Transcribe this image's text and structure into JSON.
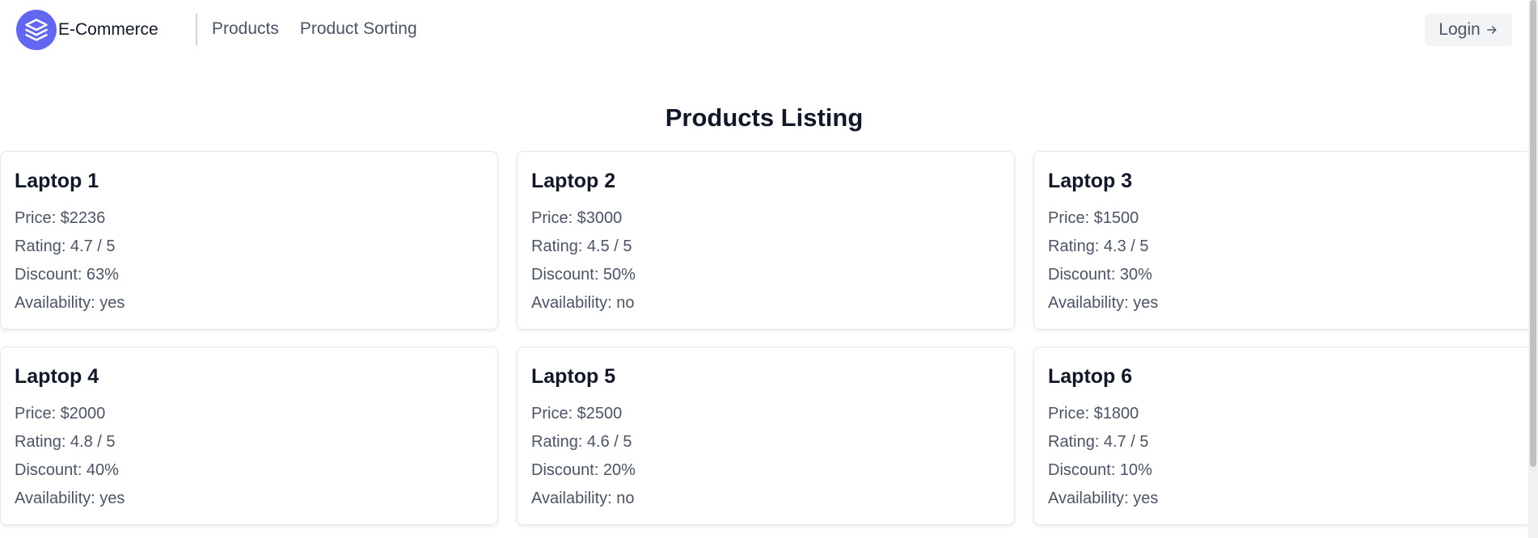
{
  "header": {
    "brand": "E-Commerce",
    "nav": [
      {
        "label": "Products"
      },
      {
        "label": "Product Sorting"
      }
    ],
    "login_label": "Login"
  },
  "main": {
    "title": "Products Listing",
    "products": [
      {
        "name": "Laptop 1",
        "price": "Price: $2236",
        "rating": "Rating: 4.7 / 5",
        "discount": "Discount: 63%",
        "availability": "Availability: yes"
      },
      {
        "name": "Laptop 2",
        "price": "Price: $3000",
        "rating": "Rating: 4.5 / 5",
        "discount": "Discount: 50%",
        "availability": "Availability: no"
      },
      {
        "name": "Laptop 3",
        "price": "Price: $1500",
        "rating": "Rating: 4.3 / 5",
        "discount": "Discount: 30%",
        "availability": "Availability: yes"
      },
      {
        "name": "Laptop 4",
        "price": "Price: $2000",
        "rating": "Rating: 4.8 / 5",
        "discount": "Discount: 40%",
        "availability": "Availability: yes"
      },
      {
        "name": "Laptop 5",
        "price": "Price: $2500",
        "rating": "Rating: 4.6 / 5",
        "discount": "Discount: 20%",
        "availability": "Availability: no"
      },
      {
        "name": "Laptop 6",
        "price": "Price: $1800",
        "rating": "Rating: 4.7 / 5",
        "discount": "Discount: 10%",
        "availability": "Availability: yes"
      }
    ]
  },
  "icons": {
    "logo": "layers-icon",
    "login": "arrow-right-icon"
  },
  "colors": {
    "accent": "#6366f1",
    "text": "#111827",
    "muted": "#4b5563"
  }
}
